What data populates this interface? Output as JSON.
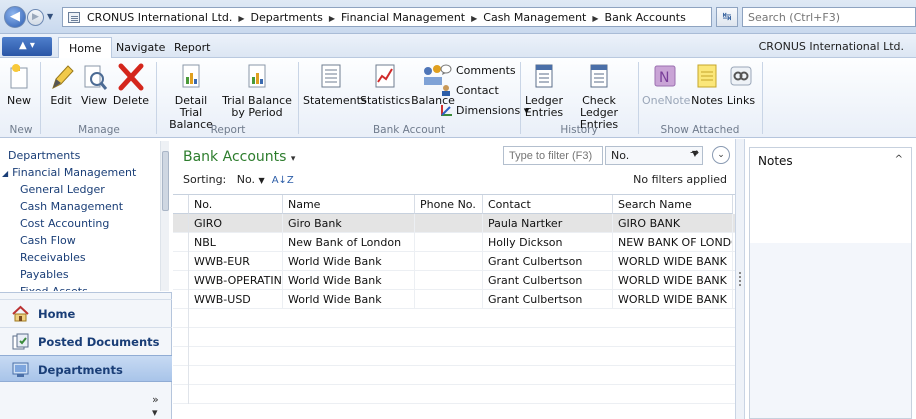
{
  "address": {
    "crumbs": [
      "CRONUS International Ltd.",
      "Departments",
      "Financial Management",
      "Cash Management",
      "Bank Accounts"
    ],
    "search_placeholder": "Search (Ctrl+F3)"
  },
  "tabs": [
    "Home",
    "Navigate",
    "Report"
  ],
  "company": "CRONUS International Ltd.",
  "ribbon": {
    "new": "New",
    "edit": "Edit",
    "view": "View",
    "delete": "Delete",
    "detail_trial_balance": [
      "Detail Trial",
      "Balance"
    ],
    "trial_balance_by_period": [
      "Trial Balance",
      "by Period"
    ],
    "statements": "Statements",
    "statistics": "Statistics",
    "balance": "Balance",
    "comments": "Comments",
    "contact": "Contact",
    "dimensions": "Dimensions",
    "ledger_entries": [
      "Ledger",
      "Entries"
    ],
    "check_ledger_entries": [
      "Check Ledger",
      "Entries"
    ],
    "onenote": "OneNote",
    "notes": "Notes",
    "links": "Links",
    "groups": {
      "new": "New",
      "manage": "Manage",
      "report": "Report",
      "bank_account": "Bank Account",
      "history": "History",
      "show_attached": "Show Attached"
    }
  },
  "nav": {
    "tree": [
      "Departments",
      "Financial Management",
      "General Ledger",
      "Cash Management",
      "Cost Accounting",
      "Cash Flow",
      "Receivables",
      "Payables",
      "Fixed Assets"
    ],
    "home": "Home",
    "posted_documents": "Posted Documents",
    "departments": "Departments"
  },
  "list": {
    "title": "Bank Accounts",
    "filter_placeholder": "Type to filter (F3)",
    "filter_field": "No.",
    "sorting_label": "Sorting:",
    "sorting_field": "No.",
    "no_filters": "No filters applied",
    "columns": [
      "No.",
      "Name",
      "Phone No.",
      "Contact",
      "Search Name"
    ],
    "rows": [
      {
        "no": "GIRO",
        "name": "Giro Bank",
        "phone": "",
        "contact": "Paula Nartker",
        "search": "GIRO BANK"
      },
      {
        "no": "NBL",
        "name": "New Bank of London",
        "phone": "",
        "contact": "Holly Dickson",
        "search": "NEW BANK OF LONDON"
      },
      {
        "no": "WWB-EUR",
        "name": "World Wide Bank",
        "phone": "",
        "contact": "Grant Culbertson",
        "search": "WORLD WIDE BANK"
      },
      {
        "no": "WWB-OPERATING",
        "name": "World Wide Bank",
        "phone": "",
        "contact": "Grant Culbertson",
        "search": "WORLD WIDE BANK"
      },
      {
        "no": "WWB-USD",
        "name": "World Wide Bank",
        "phone": "",
        "contact": "Grant Culbertson",
        "search": "WORLD WIDE BANK"
      }
    ]
  },
  "notes": {
    "title": "Notes"
  },
  "colors": {
    "title_green": "#2d7d2d",
    "nav_blue": "#1a3e77",
    "selected_row": "#e4e4e4"
  }
}
